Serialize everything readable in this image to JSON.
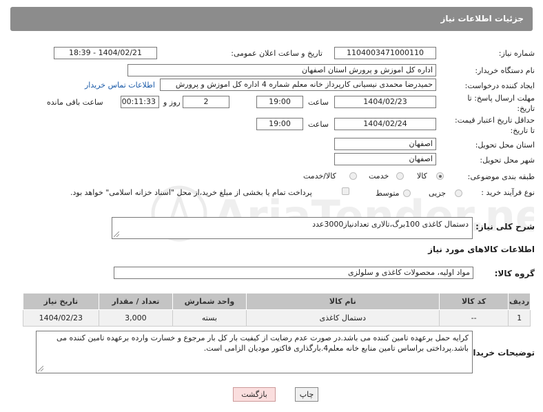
{
  "header": {
    "title": "جزئیات اطلاعات نیاز"
  },
  "form": {
    "need_number": {
      "label": "شماره نیاز:",
      "value": "1104003471000110"
    },
    "announce_datetime": {
      "label": "تاریخ و ساعت اعلان عمومی:",
      "value": "1404/02/21 - 18:39"
    },
    "buyer_org": {
      "label": "نام دستگاه خریدار:",
      "value": "اداره کل اموزش و پرورش استان اصفهان"
    },
    "requester": {
      "label": "ایجاد کننده درخواست:",
      "value": "حمیدرضا محمدی نیسیانی کارپرداز خانه معلم شماره 4 اداره کل اموزش و پرورش",
      "contact_link": "اطلاعات تماس خریدار"
    },
    "reply_deadline": {
      "label_line1": "مهلت ارسال پاسخ: تا",
      "label_line2": "تاریخ:",
      "date": "1404/02/23",
      "time_label": "ساعت",
      "time": "19:00",
      "days": "2",
      "days_label": "روز و",
      "remaining": "00:11:33",
      "remaining_label": "ساعت باقی مانده"
    },
    "price_validity": {
      "label_line1": "حداقل تاریخ اعتبار قیمت:",
      "label_line2": "تا تاریخ:",
      "date": "1404/02/24",
      "time_label": "ساعت",
      "time": "19:00"
    },
    "delivery_province": {
      "label": "استان محل تحویل:",
      "value": "اصفهان"
    },
    "delivery_city": {
      "label": "شهر محل تحویل:",
      "value": "اصفهان"
    },
    "category": {
      "label": "طبقه بندی موضوعی:",
      "options": [
        "کالا",
        "خدمت",
        "کالا/خدمت"
      ],
      "selected": "کالا"
    },
    "purchase_type": {
      "label": "نوع فرآیند خرید :",
      "options": [
        "جزیی",
        "متوسط"
      ],
      "selected": "",
      "payment_note": "پرداخت تمام یا بخشی از مبلغ خرید،از محل \"اسناد خزانه اسلامی\" خواهد بود."
    }
  },
  "need_description": {
    "label": "شرح کلی نیاز:",
    "value": "دستمال کاغذی 100برگ،تالاری تعدادنیاز3000عدد"
  },
  "goods_info_title": "اطلاعات کالاهای مورد نیاز",
  "goods_group": {
    "label": "گروه کالا:",
    "value": "مواد اولیه، محصولات کاغذی و سلولزی"
  },
  "table": {
    "headers": [
      "ردیف",
      "کد کالا",
      "نام کالا",
      "واحد شمارش",
      "تعداد / مقدار",
      "تاریخ نیاز"
    ],
    "rows": [
      [
        "1",
        "--",
        "دستمال کاغذی",
        "بسته",
        "3,000",
        "1404/02/23"
      ]
    ]
  },
  "buyer_notes": {
    "label": "توضیحات خریدار:",
    "value": "کرایه حمل برعهده تامین کننده می باشد.در صورت عدم رضایت از کیفیت بار کل بار مرجوع و خسارت وارده برعهده تامین کننده می باشد.پرداختی براساس تامین منابع خانه معلم4.بارگذاری فاکتور مودیان الزامی است."
  },
  "buttons": {
    "print": "چاپ",
    "back": "بازگشت"
  }
}
